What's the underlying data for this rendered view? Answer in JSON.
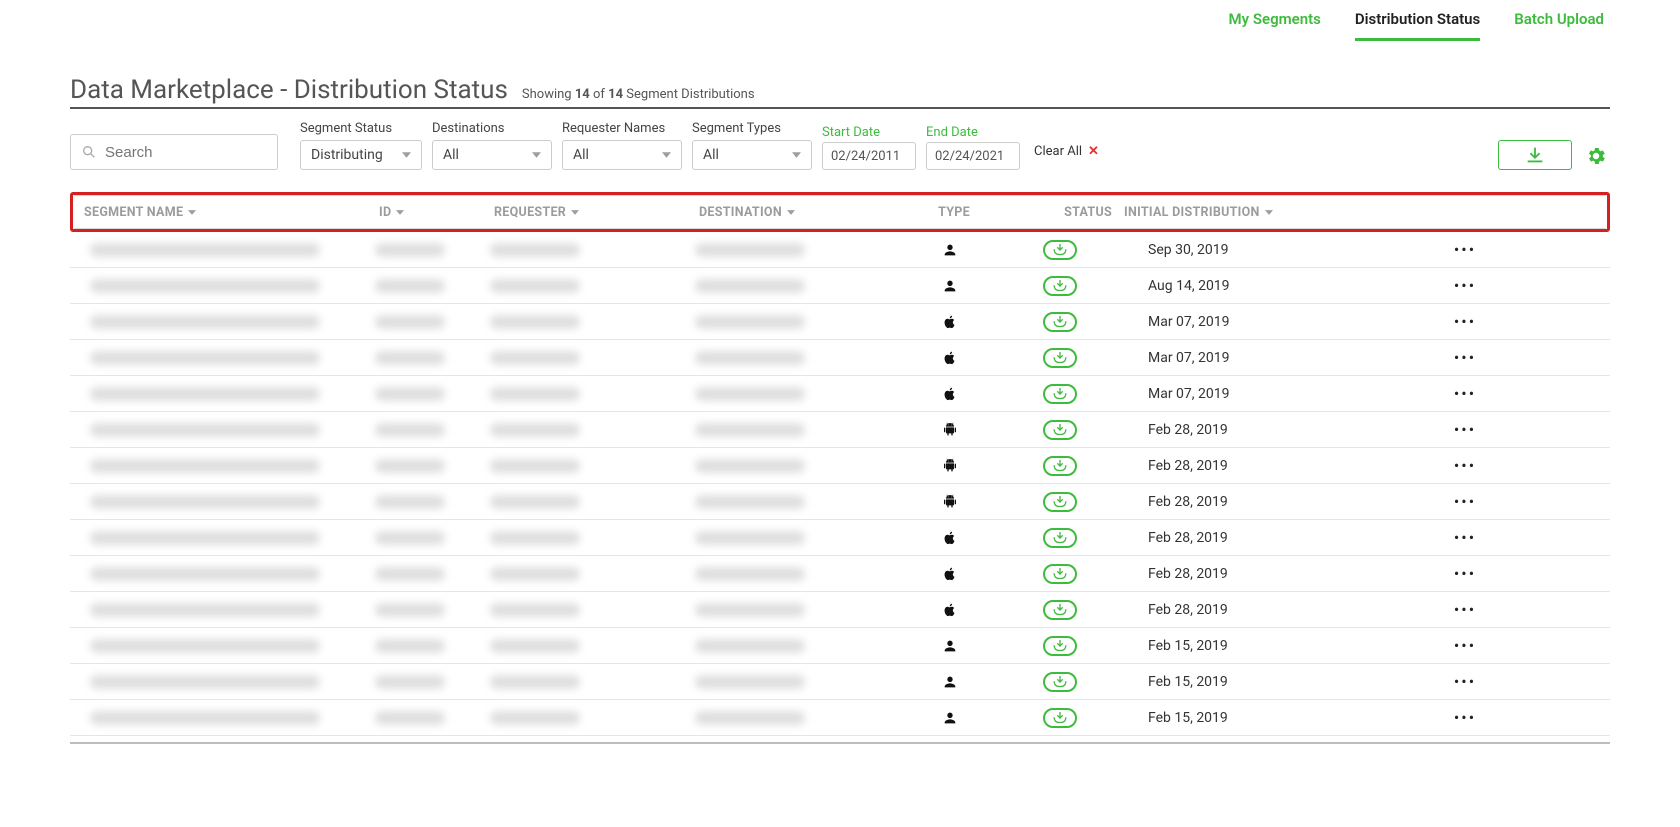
{
  "nav": {
    "my_segments": "My Segments",
    "distribution_status": "Distribution Status",
    "batch_upload": "Batch Upload"
  },
  "title": "Data Marketplace - Distribution Status",
  "subtitle_prefix": "Showing ",
  "subtitle_count": "14",
  "subtitle_of": " of ",
  "subtitle_total": "14",
  "subtitle_suffix": " Segment Distributions",
  "search_placeholder": "Search",
  "filters": {
    "segment_status_label": "Segment Status",
    "segment_status_value": "Distributing",
    "destinations_label": "Destinations",
    "destinations_value": "All",
    "requesters_label": "Requester Names",
    "requesters_value": "All",
    "segment_types_label": "Segment Types",
    "segment_types_value": "All",
    "start_date_label": "Start Date",
    "start_date_value": "02/24/2011",
    "end_date_label": "End Date",
    "end_date_value": "02/24/2021",
    "clear_all": "Clear All"
  },
  "columns": {
    "name": "SEGMENT NAME",
    "id": "ID",
    "requester": "REQUESTER",
    "destination": "DESTINATION",
    "type": "TYPE",
    "status": "STATUS",
    "initial_distribution": "INITIAL DISTRIBUTION"
  },
  "rows": [
    {
      "type_icon": "user",
      "date": "Sep 30, 2019"
    },
    {
      "type_icon": "user",
      "date": "Aug 14, 2019"
    },
    {
      "type_icon": "apple",
      "date": "Mar 07, 2019"
    },
    {
      "type_icon": "apple",
      "date": "Mar 07, 2019"
    },
    {
      "type_icon": "apple",
      "date": "Mar 07, 2019"
    },
    {
      "type_icon": "android",
      "date": "Feb 28, 2019"
    },
    {
      "type_icon": "android",
      "date": "Feb 28, 2019"
    },
    {
      "type_icon": "android",
      "date": "Feb 28, 2019"
    },
    {
      "type_icon": "apple",
      "date": "Feb 28, 2019"
    },
    {
      "type_icon": "apple",
      "date": "Feb 28, 2019"
    },
    {
      "type_icon": "apple",
      "date": "Feb 28, 2019"
    },
    {
      "type_icon": "user",
      "date": "Feb 15, 2019"
    },
    {
      "type_icon": "user",
      "date": "Feb 15, 2019"
    },
    {
      "type_icon": "user",
      "date": "Feb 15, 2019"
    }
  ]
}
